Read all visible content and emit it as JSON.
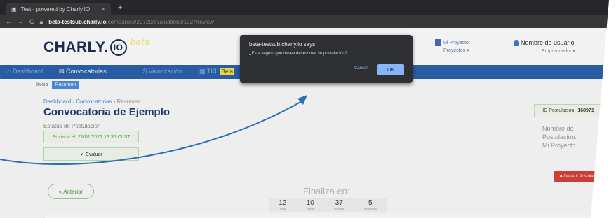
{
  "browser": {
    "tab_title": "Test - powered by Charly.IO",
    "tab_close": "×",
    "new_tab": "+",
    "url_host": "beta-testsub.charly.io",
    "url_path": "/companies/20720/evaluations/1027/review"
  },
  "header": {
    "logo_text": "CHARLY.",
    "logo_mark": "IO",
    "logo_badge": "beta",
    "project_label": "Mi Proyecto",
    "project_sub": "Proyectos ▾",
    "user_name": "Nombre de usuario",
    "user_role": "Emprendedor ▾"
  },
  "nav": {
    "dashboard": "Dashboard",
    "convocatorias": "Convocatorias",
    "valorizacion": "Valorización",
    "tkl": "TKL",
    "beta": "Beta"
  },
  "subtabs": {
    "inicio": "Inicio",
    "resumen": "Resumen"
  },
  "breadcrumb": {
    "dashboard": "Dashboard",
    "sep1": " › ",
    "convocatorias": "Convocatorias",
    "sep2": " › ",
    "current": "Resumen"
  },
  "page": {
    "title": "Convocatoria de Ejemplo",
    "estado_label": "Estatus de Postulación",
    "enviada": "Enviada el: 21/01/2021 13:36 CLST",
    "evaluar": "✔ Evaluar",
    "id_label": "ID Postulación:",
    "id_value": "168971",
    "nombre_label": "Nombre de Postulación:",
    "nombre_value": "Mi Proyecto",
    "desistir": "✖ Desistir Postulación",
    "anterior": "« Anterior",
    "finaliza": "Finaliza en:"
  },
  "timer": [
    {
      "num": "12",
      "lab": "Días"
    },
    {
      "num": "10",
      "lab": "Horas"
    },
    {
      "num": "37",
      "lab": "Minutos"
    },
    {
      "num": "5",
      "lab": "Segundos"
    }
  ],
  "dialog": {
    "title": "beta-testsub.charly.io says",
    "message": "¿Esta seguro que desea desestimar su postulación?",
    "cancel": "Cancel",
    "ok": "OK"
  },
  "colors": {
    "nav_blue": "#2b63ac",
    "arrow": "#2f6db5",
    "danger": "#d7413c",
    "dialog_bg": "#2f3033"
  }
}
